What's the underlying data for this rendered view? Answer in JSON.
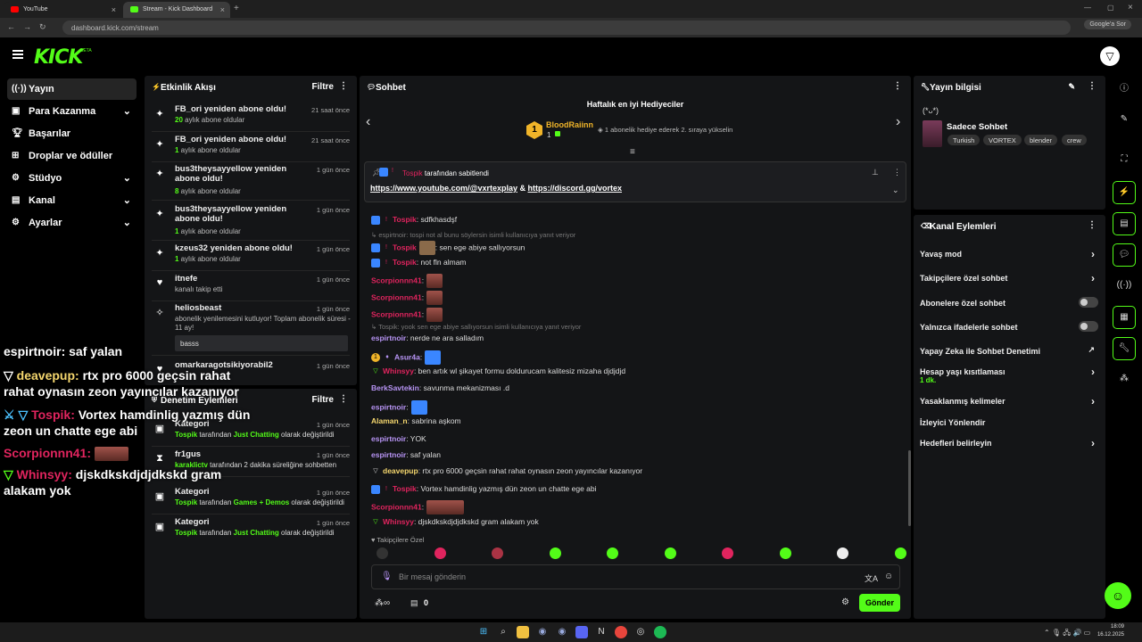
{
  "browser": {
    "tabs": [
      {
        "label": "YouTube",
        "color": "#ff0000"
      },
      {
        "label": "Stream - Kick Dashboard",
        "color": "#53fc18"
      }
    ],
    "url": "dashboard.kick.com/stream",
    "google_search": "Google'a Sor"
  },
  "brand": {
    "logo": "KICK",
    "beta": "BETA",
    "accent": "#53fc18"
  },
  "sidebar": {
    "items": [
      {
        "label": "Yayın",
        "icon": "broadcast-icon"
      },
      {
        "label": "Para Kazanma",
        "icon": "wallet-icon"
      },
      {
        "label": "Başarılar",
        "icon": "trophy-icon"
      },
      {
        "label": "Droplar ve ödüller",
        "icon": "gift-icon"
      },
      {
        "label": "Stüdyo",
        "icon": "sliders-icon"
      },
      {
        "label": "Kanal",
        "icon": "channel-icon"
      },
      {
        "label": "Ayarlar",
        "icon": "gear-icon"
      }
    ]
  },
  "overlay_chat": [
    {
      "user": "espirtnoir:",
      "text": "saf yalan",
      "color": "#ffffff"
    },
    {
      "user": "deavepup:",
      "text": "rtx pro 6000 geçsin rahat rahat oynasın zeon yayıncılar kazanıyor",
      "color": "#f5d76e"
    },
    {
      "user": "Tospik:",
      "text": "Vortex hamdinlig yazmış dün zeon un chatte ege abi",
      "color": "#e0245e"
    },
    {
      "user": "Scorpionnn41:",
      "text": "",
      "color": "#e0245e"
    },
    {
      "user": "Whinsyy:",
      "text": "djskdkskdjdjdkskd gram alakam yok",
      "color": "#e0245e"
    }
  ],
  "activity": {
    "title": "Etkinlik Akışı",
    "filter": "Filtre",
    "events": [
      {
        "title": "FB_ori yeniden abone oldu!",
        "num": "20",
        "sub": " aylık abone oldular",
        "time": "21 saat önce"
      },
      {
        "title": "FB_ori yeniden abone oldu!",
        "num": "1",
        "sub": " aylık abone oldular",
        "time": "21 saat önce"
      },
      {
        "title": "bus3theysayyellow yeniden abone oldu!",
        "num": "8",
        "sub": " aylık abone oldular",
        "time": "1 gün önce"
      },
      {
        "title": "bus3theysayyellow yeniden abone oldu!",
        "num": "1",
        "sub": " aylık abone oldular",
        "time": "1 gün önce"
      },
      {
        "title": "kzeus32 yeniden abone oldu!",
        "num": "1",
        "sub": " aylık abone oldular",
        "time": "1 gün önce"
      },
      {
        "title": "itnefe",
        "num": "",
        "sub": "kanalı takip etti",
        "time": "1 gün önce"
      },
      {
        "title": "heliosbeast",
        "num": "",
        "sub": "abonelik yenilemesini kutluyor! Toplam abonelik süresi - 11 ay!",
        "time": "1 gün önce",
        "quote": "basss"
      },
      {
        "title": "omarkaragotsikiyorabil2",
        "num": "",
        "sub": "",
        "time": "1 gün önce"
      }
    ]
  },
  "moderation": {
    "title": "Denetim Eylemleri",
    "filter": "Filtre",
    "events": [
      {
        "title": "Kategori",
        "actor": "Tospik",
        "mid": " tarafından ",
        "target": "Just Chatting",
        "end": " olarak değiştirildi",
        "time": "1 gün önce"
      },
      {
        "title": "fr1gus",
        "actor": "karaklictv",
        "mid": " tarafından 2 dakika süreliğine sohbetten",
        "target": "",
        "end": "",
        "time": "1 gün önce"
      },
      {
        "title": "Kategori",
        "actor": "Tospik",
        "mid": " tarafından ",
        "target": "Games + Demos",
        "end": " olarak değiştirildi",
        "time": "1 gün önce"
      },
      {
        "title": "Kategori",
        "actor": "Tospik",
        "mid": " tarafından ",
        "target": "Just Chatting",
        "end": " olarak değiştirildi",
        "time": "1 gün önce"
      }
    ]
  },
  "chat": {
    "title": "Sohbet",
    "gifters_title": "Haftalık en iyi Hediyeciler",
    "gifter_name": "BloodRaiinn",
    "gifter_rank": "1",
    "gifter_count": "1",
    "gifter_note": "1 abonelik hediye ederek 2. sıraya yükselin",
    "pinned_by": "Tospik",
    "pinned_suffix": " tarafından sabitlendi",
    "pinned_link1": "https://www.youtube.com/@vxrtexplay",
    "pinned_amp": " & ",
    "pinned_link2": "https://discord.gg/vortex",
    "messages": [
      {
        "kind": "msg",
        "user": "Tospik",
        "color": "#e0245e",
        "text": ": sdfkhasdşf"
      },
      {
        "kind": "reply",
        "text": "espirtnoir: tospi not al bunu söylersin isimli kullanıcıya yanıt veriyor"
      },
      {
        "kind": "msg",
        "user": "Tospik",
        "color": "#e0245e",
        "text": ": sen ege abiye sallıyorsun"
      },
      {
        "kind": "msg",
        "user": "Tospik",
        "color": "#e0245e",
        "text": ": not fln almam"
      },
      {
        "kind": "msg",
        "user": "Scorpionnn41",
        "color": "#e0245e",
        "text": ":"
      },
      {
        "kind": "msg",
        "user": "Scorpionnn41",
        "color": "#e0245e",
        "text": ":"
      },
      {
        "kind": "msg",
        "user": "Scorpionnn41",
        "color": "#e0245e",
        "text": ":"
      },
      {
        "kind": "reply",
        "text": "Tospik: yook sen ege abiye sallıyorsun isimli kullanıcıya yanıt veriyor"
      },
      {
        "kind": "msg",
        "user": "espirtnoir",
        "color": "#b794f4",
        "text": ": nerde ne ara salladım"
      },
      {
        "kind": "msg",
        "user": "Asur4a",
        "color": "#b794f4",
        "text": ":"
      },
      {
        "kind": "msg",
        "user": "Whinsyy",
        "color": "#e0245e",
        "text": ": ben artık wl şikayet formu doldurucam kalitesiz mizaha djdjdjd"
      },
      {
        "kind": "msg",
        "user": "BerkSavtekin",
        "color": "#b794f4",
        "text": ": savunma mekanizması .d"
      },
      {
        "kind": "msg",
        "user": "espirtnoir",
        "color": "#b794f4",
        "text": ":"
      },
      {
        "kind": "msg",
        "user": "Alaman_n",
        "color": "#f5d76e",
        "text": ": sabrina aşkom"
      },
      {
        "kind": "msg",
        "user": "espirtnoir",
        "color": "#b794f4",
        "text": ": YOK"
      },
      {
        "kind": "msg",
        "user": "espirtnoir",
        "color": "#b794f4",
        "text": ": saf yalan"
      },
      {
        "kind": "msg",
        "user": "deavepup",
        "color": "#f5d76e",
        "text": ": rtx pro 6000 geçsin rahat rahat oynasın zeon yayıncılar kazanıyor"
      },
      {
        "kind": "msg",
        "user": "Tospik",
        "color": "#e0245e",
        "text": ": Vortex hamdinlig yazmış dün zeon un chatte ege abi"
      },
      {
        "kind": "msg",
        "user": "Scorpionnn41",
        "color": "#e0245e",
        "text": ":"
      },
      {
        "kind": "msg",
        "user": "Whinsyy",
        "color": "#e0245e",
        "text": ": djskdkskdjdjdkskd gram alakam yok"
      }
    ],
    "followers_label": "Takipçilere Özel",
    "placeholder": "Bir mesaj gönderin",
    "points": "0",
    "send": "Gönder"
  },
  "stream_info": {
    "title": "Yayın bilgisi",
    "kaomoji": "(*ᴗ*)",
    "stream_title": "Sadece Sohbet",
    "tags": [
      "Turkish",
      "VORTEX",
      "blender",
      "crew"
    ]
  },
  "channel_actions": {
    "title": "Kanal Eylemleri",
    "items": [
      {
        "label": "Yavaş mod",
        "type": "arrow"
      },
      {
        "label": "Takipçilere özel sohbet",
        "type": "arrow"
      },
      {
        "label": "Abonelere özel sohbet",
        "type": "toggle"
      },
      {
        "label": "Yalnızca ifadelerle sohbet",
        "type": "toggle"
      },
      {
        "label": "Yapay Zeka ile Sohbet Denetimi",
        "type": "external"
      },
      {
        "label": "Hesap yaşı kısıtlaması",
        "type": "arrow",
        "sub": "1 dk."
      },
      {
        "label": "Yasaklanmış kelimeler",
        "type": "arrow"
      },
      {
        "label": "İzleyici Yönlendir",
        "type": "none"
      },
      {
        "label": "Hedefleri belirleyin",
        "type": "arrow"
      }
    ]
  },
  "taskbar": {
    "time": "18:09",
    "date": "16.12.2025"
  }
}
